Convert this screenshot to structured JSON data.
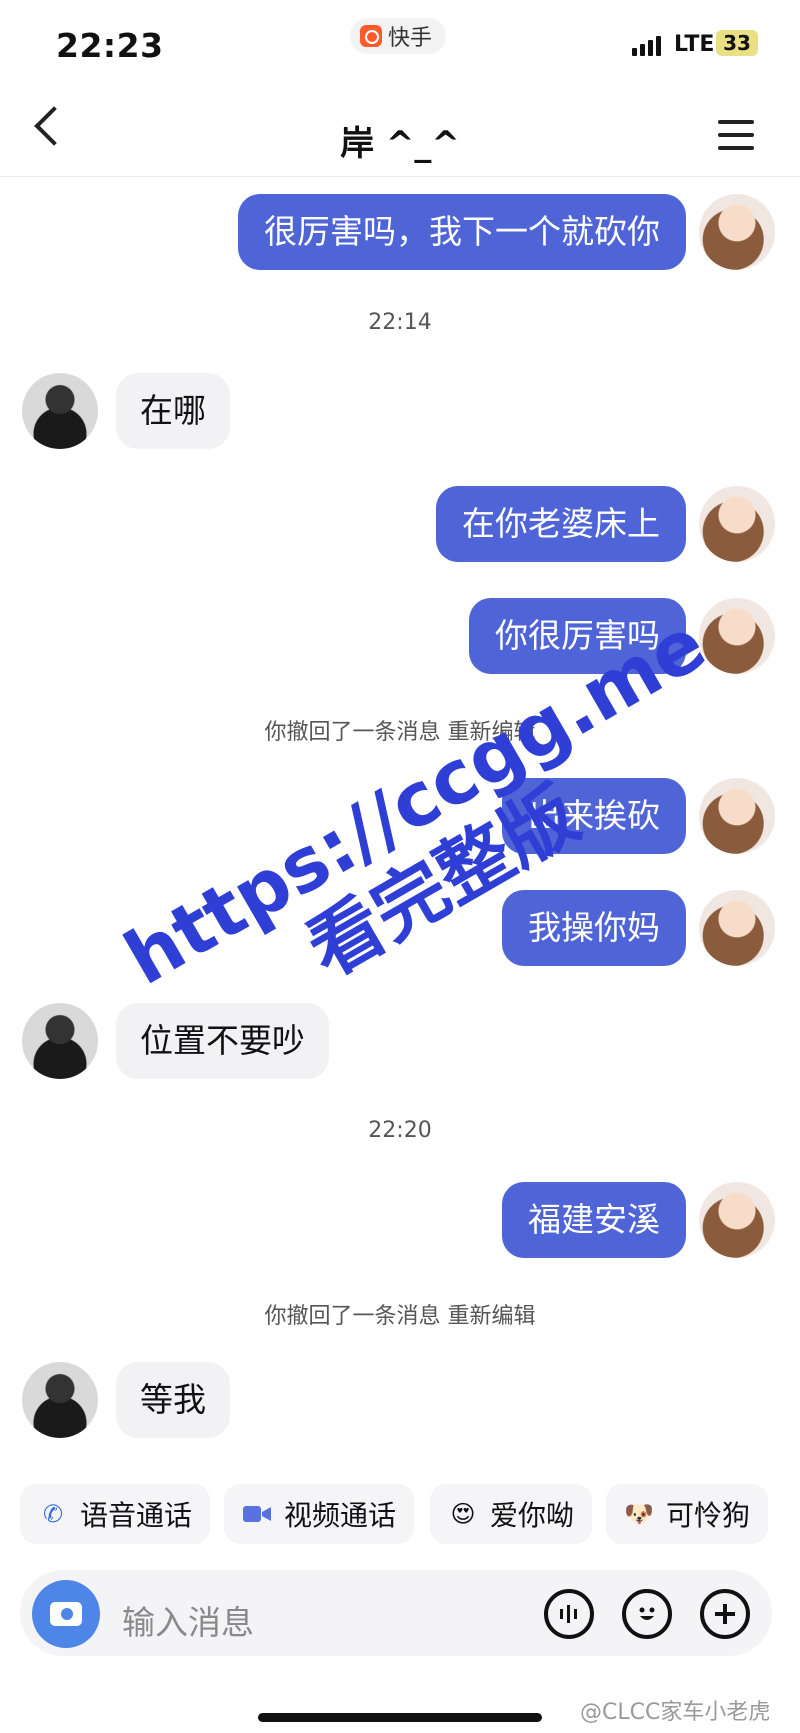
{
  "status": {
    "time": "22:23",
    "app_name": "快手",
    "network": "LTE",
    "battery": "33"
  },
  "header": {
    "title": "岸 ^_^"
  },
  "messages": [
    {
      "from": "me",
      "text": "很厉害吗，我下一个就砍你"
    },
    {
      "timestamp": "22:14"
    },
    {
      "from": "other",
      "text": "在哪"
    },
    {
      "from": "me",
      "text": "在你老婆床上"
    },
    {
      "from": "me",
      "text": "你很厉害吗"
    },
    {
      "system": "你撤回了一条消息 重新编辑"
    },
    {
      "from": "me",
      "text": "出来挨砍"
    },
    {
      "from": "me",
      "text": "我操你妈"
    },
    {
      "from": "other",
      "text": "位置不要吵"
    },
    {
      "timestamp": "22:20"
    },
    {
      "from": "me",
      "text": "福建安溪"
    },
    {
      "system": "你撤回了一条消息 重新编辑"
    },
    {
      "from": "other",
      "text": "等我"
    }
  ],
  "watermark": {
    "line1": "https://ccgg.me",
    "line2": "看完整版"
  },
  "quick_actions": [
    {
      "label": "语音通话",
      "icon": "phone-icon"
    },
    {
      "label": "视频通话",
      "icon": "video-camera-icon"
    },
    {
      "label": "爱你呦",
      "icon": "heart-eyes-emoji-icon"
    },
    {
      "label": "可怜狗",
      "icon": "dog-emoji-icon"
    }
  ],
  "input": {
    "placeholder": "输入消息"
  },
  "footer": {
    "source": "@CLCC家车小老虎"
  },
  "colors": {
    "outgoing_bubble": "#4e64d7",
    "incoming_bubble": "#f2f2f4",
    "watermark": "#2f3fd6",
    "camera_button": "#4d86e6"
  }
}
